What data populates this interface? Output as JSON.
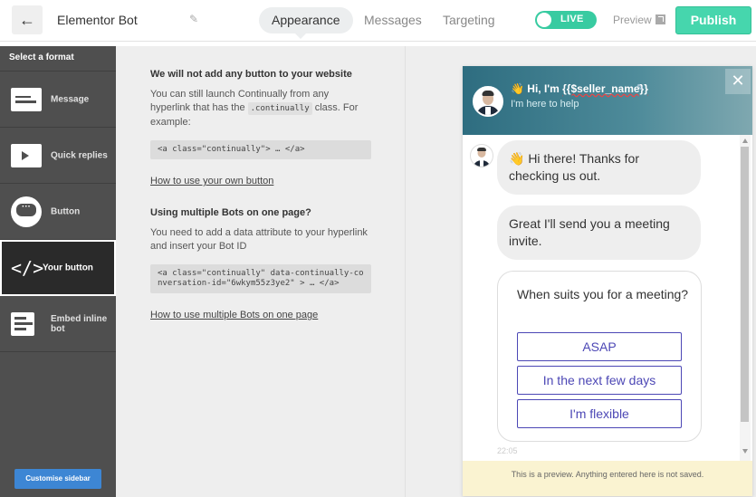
{
  "topbar": {
    "back_label": "←",
    "bot_name": "Elementor Bot",
    "edit_icon": "✎",
    "tabs": [
      {
        "label": "Appearance",
        "active": true
      },
      {
        "label": "Messages",
        "active": false
      },
      {
        "label": "Targeting",
        "active": false
      }
    ],
    "live_label": "LIVE",
    "preview_label": "Preview",
    "publish_label": "Publish",
    "colors": {
      "live": "#38cba1",
      "publish": "#46d6ad"
    }
  },
  "sidebar": {
    "header": "Select a format",
    "items": [
      {
        "label": "Message",
        "icon": "message-format-icon"
      },
      {
        "label": "Quick replies",
        "icon": "quick-replies-icon"
      },
      {
        "label": "Button",
        "icon": "chat-bubble-icon"
      },
      {
        "label": "Your button",
        "icon": "code-icon",
        "active": true
      },
      {
        "label": "Embed inline bot",
        "icon": "embed-inline-icon"
      }
    ],
    "customise_label": "Customise sidebar"
  },
  "middle": {
    "section1": {
      "title": "We will not add any button to your website",
      "text_before": "You can still launch Continually from any hyperlink that has the ",
      "inline_code": ".continually",
      "text_after": " class. For example:",
      "code": "<a class=\"continually\"> … </a>",
      "link": "How to use your own button"
    },
    "section2": {
      "title": "Using multiple Bots on one page?",
      "text": "You need to add a data attribute to your hyperlink and insert your Bot ID",
      "code": "<a class=\"continually\" data-continually-conversation-id=\"6wkym55z3ye2\" > … </a>",
      "link": "How to use multiple Bots on one page"
    }
  },
  "widget": {
    "title_prefix": "👋 Hi, I'm ",
    "title_var": "{{$seller_name}}",
    "subtitle": "I'm here to help",
    "close_label": "✕",
    "messages": [
      "👋 Hi there! Thanks for checking us out.",
      "Great I'll send you a meeting invite."
    ],
    "question": "When suits you for a meeting?",
    "options": [
      "ASAP",
      "In the next few days",
      "I'm flexible"
    ],
    "timestamp": "22:05",
    "preview_notice": "This is a preview. Anything entered here is not saved."
  }
}
